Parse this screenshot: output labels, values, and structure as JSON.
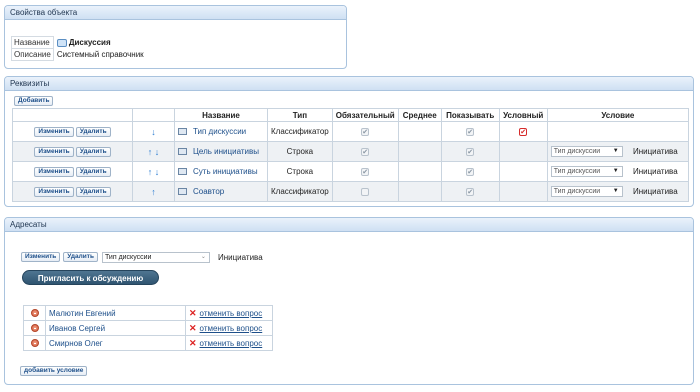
{
  "properties": {
    "header": "Свойства объекта",
    "name_label": "Название",
    "name_value": "Дискуссия",
    "description_label": "Описание",
    "description_value": "Системный справочник"
  },
  "requisites": {
    "header": "Реквизиты",
    "add_button": "Добавить",
    "columns": [
      "Название",
      "Тип",
      "Обязательный",
      "Среднее",
      "Показывать",
      "Условный",
      "Условие"
    ],
    "edit_label": "Изменить",
    "delete_label": "Удалить",
    "rows": [
      {
        "arrows": "↓",
        "name": "Тип дискуссии",
        "type": "Классификатор",
        "required": "✔",
        "show": "✔",
        "conditional": "✔",
        "condition_select": "",
        "condition_value": ""
      },
      {
        "arrows": "↑ ↓",
        "name": "Цель инициативы",
        "type": "Строка",
        "required": "✔",
        "show": "✔",
        "conditional": "",
        "condition_select": "Тип дискуссии",
        "condition_value": "Инициатива"
      },
      {
        "arrows": "↑ ↓",
        "name": "Суть инициативы",
        "type": "Строка",
        "required": "✔",
        "show": "✔",
        "conditional": "",
        "condition_select": "Тип дискуссии",
        "condition_value": "Инициатива"
      },
      {
        "arrows": "↑",
        "name": "Соавтор",
        "type": "Классификатор",
        "required": "",
        "show": "✔",
        "conditional": "",
        "condition_select": "Тип дискуссии",
        "condition_value": "Инициатива"
      }
    ]
  },
  "addressees": {
    "header": "Адресаты",
    "edit_label": "Изменить",
    "delete_label": "Удалить",
    "select_value": "Тип дискуссии",
    "condition_value": "Инициатива",
    "invite_button": "Пригласить к обсуждению",
    "cancel_label": "отменить вопрос",
    "people": [
      "Малютин Евгений",
      "Иванов Сергей",
      "Смирнов Олег"
    ],
    "add_condition_button": "добавить условие"
  }
}
